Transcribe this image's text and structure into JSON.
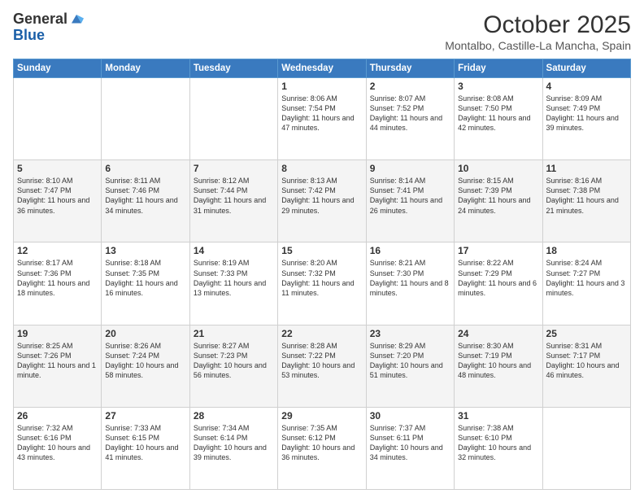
{
  "logo": {
    "line1": "General",
    "line2": "Blue"
  },
  "title": "October 2025",
  "location": "Montalbo, Castille-La Mancha, Spain",
  "days_of_week": [
    "Sunday",
    "Monday",
    "Tuesday",
    "Wednesday",
    "Thursday",
    "Friday",
    "Saturday"
  ],
  "weeks": [
    [
      {
        "day": "",
        "info": ""
      },
      {
        "day": "",
        "info": ""
      },
      {
        "day": "",
        "info": ""
      },
      {
        "day": "1",
        "info": "Sunrise: 8:06 AM\nSunset: 7:54 PM\nDaylight: 11 hours and 47 minutes."
      },
      {
        "day": "2",
        "info": "Sunrise: 8:07 AM\nSunset: 7:52 PM\nDaylight: 11 hours and 44 minutes."
      },
      {
        "day": "3",
        "info": "Sunrise: 8:08 AM\nSunset: 7:50 PM\nDaylight: 11 hours and 42 minutes."
      },
      {
        "day": "4",
        "info": "Sunrise: 8:09 AM\nSunset: 7:49 PM\nDaylight: 11 hours and 39 minutes."
      }
    ],
    [
      {
        "day": "5",
        "info": "Sunrise: 8:10 AM\nSunset: 7:47 PM\nDaylight: 11 hours and 36 minutes."
      },
      {
        "day": "6",
        "info": "Sunrise: 8:11 AM\nSunset: 7:46 PM\nDaylight: 11 hours and 34 minutes."
      },
      {
        "day": "7",
        "info": "Sunrise: 8:12 AM\nSunset: 7:44 PM\nDaylight: 11 hours and 31 minutes."
      },
      {
        "day": "8",
        "info": "Sunrise: 8:13 AM\nSunset: 7:42 PM\nDaylight: 11 hours and 29 minutes."
      },
      {
        "day": "9",
        "info": "Sunrise: 8:14 AM\nSunset: 7:41 PM\nDaylight: 11 hours and 26 minutes."
      },
      {
        "day": "10",
        "info": "Sunrise: 8:15 AM\nSunset: 7:39 PM\nDaylight: 11 hours and 24 minutes."
      },
      {
        "day": "11",
        "info": "Sunrise: 8:16 AM\nSunset: 7:38 PM\nDaylight: 11 hours and 21 minutes."
      }
    ],
    [
      {
        "day": "12",
        "info": "Sunrise: 8:17 AM\nSunset: 7:36 PM\nDaylight: 11 hours and 18 minutes."
      },
      {
        "day": "13",
        "info": "Sunrise: 8:18 AM\nSunset: 7:35 PM\nDaylight: 11 hours and 16 minutes."
      },
      {
        "day": "14",
        "info": "Sunrise: 8:19 AM\nSunset: 7:33 PM\nDaylight: 11 hours and 13 minutes."
      },
      {
        "day": "15",
        "info": "Sunrise: 8:20 AM\nSunset: 7:32 PM\nDaylight: 11 hours and 11 minutes."
      },
      {
        "day": "16",
        "info": "Sunrise: 8:21 AM\nSunset: 7:30 PM\nDaylight: 11 hours and 8 minutes."
      },
      {
        "day": "17",
        "info": "Sunrise: 8:22 AM\nSunset: 7:29 PM\nDaylight: 11 hours and 6 minutes."
      },
      {
        "day": "18",
        "info": "Sunrise: 8:24 AM\nSunset: 7:27 PM\nDaylight: 11 hours and 3 minutes."
      }
    ],
    [
      {
        "day": "19",
        "info": "Sunrise: 8:25 AM\nSunset: 7:26 PM\nDaylight: 11 hours and 1 minute."
      },
      {
        "day": "20",
        "info": "Sunrise: 8:26 AM\nSunset: 7:24 PM\nDaylight: 10 hours and 58 minutes."
      },
      {
        "day": "21",
        "info": "Sunrise: 8:27 AM\nSunset: 7:23 PM\nDaylight: 10 hours and 56 minutes."
      },
      {
        "day": "22",
        "info": "Sunrise: 8:28 AM\nSunset: 7:22 PM\nDaylight: 10 hours and 53 minutes."
      },
      {
        "day": "23",
        "info": "Sunrise: 8:29 AM\nSunset: 7:20 PM\nDaylight: 10 hours and 51 minutes."
      },
      {
        "day": "24",
        "info": "Sunrise: 8:30 AM\nSunset: 7:19 PM\nDaylight: 10 hours and 48 minutes."
      },
      {
        "day": "25",
        "info": "Sunrise: 8:31 AM\nSunset: 7:17 PM\nDaylight: 10 hours and 46 minutes."
      }
    ],
    [
      {
        "day": "26",
        "info": "Sunrise: 7:32 AM\nSunset: 6:16 PM\nDaylight: 10 hours and 43 minutes."
      },
      {
        "day": "27",
        "info": "Sunrise: 7:33 AM\nSunset: 6:15 PM\nDaylight: 10 hours and 41 minutes."
      },
      {
        "day": "28",
        "info": "Sunrise: 7:34 AM\nSunset: 6:14 PM\nDaylight: 10 hours and 39 minutes."
      },
      {
        "day": "29",
        "info": "Sunrise: 7:35 AM\nSunset: 6:12 PM\nDaylight: 10 hours and 36 minutes."
      },
      {
        "day": "30",
        "info": "Sunrise: 7:37 AM\nSunset: 6:11 PM\nDaylight: 10 hours and 34 minutes."
      },
      {
        "day": "31",
        "info": "Sunrise: 7:38 AM\nSunset: 6:10 PM\nDaylight: 10 hours and 32 minutes."
      },
      {
        "day": "",
        "info": ""
      }
    ]
  ]
}
